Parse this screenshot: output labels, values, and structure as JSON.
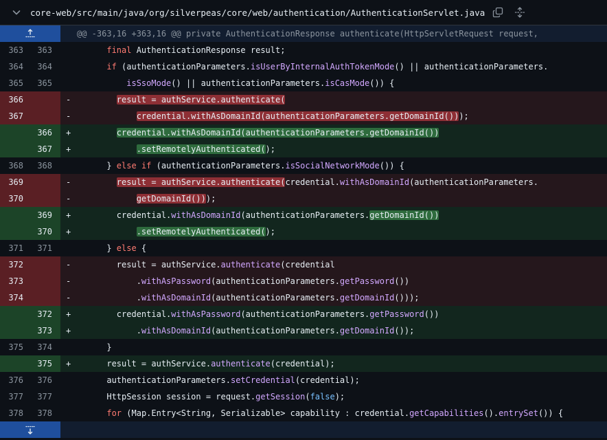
{
  "file": {
    "path": "core-web/src/main/java/org/silverpeas/core/web/authentication/AuthenticationServlet.java"
  },
  "hunk": {
    "header": "@@ -363,16 +363,16 @@ private AuthenticationResponse authenticate(HttpServletRequest request,"
  },
  "lines": [
    {
      "old": "363",
      "new": "363",
      "sign": "",
      "type": "ctx",
      "segs": [
        {
          "t": "      "
        },
        {
          "t": "final",
          "c": "kw"
        },
        {
          "t": " AuthenticationResponse result;"
        }
      ]
    },
    {
      "old": "364",
      "new": "364",
      "sign": "",
      "type": "ctx",
      "segs": [
        {
          "t": "      "
        },
        {
          "t": "if",
          "c": "kw"
        },
        {
          "t": " (authenticationParameters."
        },
        {
          "t": "isUserByInternalAuthTokenMode",
          "c": "fn"
        },
        {
          "t": "() || authenticationParameters."
        }
      ]
    },
    {
      "old": "365",
      "new": "365",
      "sign": "",
      "type": "ctx",
      "segs": [
        {
          "t": "          "
        },
        {
          "t": "isSsoMode",
          "c": "fn"
        },
        {
          "t": "() || authenticationParameters."
        },
        {
          "t": "isCasMode",
          "c": "fn"
        },
        {
          "t": "()) {"
        }
      ]
    },
    {
      "old": "366",
      "new": "",
      "sign": "-",
      "type": "del",
      "segs": [
        {
          "t": "        "
        },
        {
          "t": "result = authService.authenticate(",
          "c": "hl-del"
        }
      ]
    },
    {
      "old": "367",
      "new": "",
      "sign": "-",
      "type": "del",
      "segs": [
        {
          "t": "            "
        },
        {
          "t": "credential.withAsDomainId(authenticationParameters.getDomainId())",
          "c": "hl-del"
        },
        {
          "t": ");"
        }
      ]
    },
    {
      "old": "",
      "new": "366",
      "sign": "+",
      "type": "add",
      "segs": [
        {
          "t": "        "
        },
        {
          "t": "credential.withAsDomainId(authenticationParameters.getDomainId())",
          "c": "hl-add"
        }
      ]
    },
    {
      "old": "",
      "new": "367",
      "sign": "+",
      "type": "add",
      "segs": [
        {
          "t": "            "
        },
        {
          "t": ".setRemotelyAuthenticated(",
          "c": "hl-add"
        },
        {
          "t": ");"
        }
      ]
    },
    {
      "old": "368",
      "new": "368",
      "sign": "",
      "type": "ctx",
      "segs": [
        {
          "t": "      } "
        },
        {
          "t": "else",
          "c": "kw"
        },
        {
          "t": " "
        },
        {
          "t": "if",
          "c": "kw"
        },
        {
          "t": " (authenticationParameters."
        },
        {
          "t": "isSocialNetworkMode",
          "c": "fn"
        },
        {
          "t": "()) {"
        }
      ]
    },
    {
      "old": "369",
      "new": "",
      "sign": "-",
      "type": "del",
      "segs": [
        {
          "t": "        "
        },
        {
          "t": "result = authService.authenticate(",
          "c": "hl-del"
        },
        {
          "t": "credential."
        },
        {
          "t": "withAsDomainId",
          "c": "fn"
        },
        {
          "t": "(authenticationParameters."
        }
      ]
    },
    {
      "old": "370",
      "new": "",
      "sign": "-",
      "type": "del",
      "segs": [
        {
          "t": "            "
        },
        {
          "t": "getDomainId())",
          "c": "hl-del"
        },
        {
          "t": ");"
        }
      ]
    },
    {
      "old": "",
      "new": "369",
      "sign": "+",
      "type": "add",
      "segs": [
        {
          "t": "        credential."
        },
        {
          "t": "withAsDomainId",
          "c": "fn"
        },
        {
          "t": "(authenticationParameters."
        },
        {
          "t": "getDomainId())",
          "c": "hl-add"
        }
      ]
    },
    {
      "old": "",
      "new": "370",
      "sign": "+",
      "type": "add",
      "segs": [
        {
          "t": "            "
        },
        {
          "t": ".setRemotelyAuthenticated(",
          "c": "hl-add"
        },
        {
          "t": ");"
        }
      ]
    },
    {
      "old": "371",
      "new": "371",
      "sign": "",
      "type": "ctx",
      "segs": [
        {
          "t": "      } "
        },
        {
          "t": "else",
          "c": "kw"
        },
        {
          "t": " {"
        }
      ]
    },
    {
      "old": "372",
      "new": "",
      "sign": "-",
      "type": "del",
      "segs": [
        {
          "t": "        result = authService."
        },
        {
          "t": "authenticate",
          "c": "fn"
        },
        {
          "t": "(credential"
        }
      ]
    },
    {
      "old": "373",
      "new": "",
      "sign": "-",
      "type": "del",
      "segs": [
        {
          "t": "            ."
        },
        {
          "t": "withAsPassword",
          "c": "fn"
        },
        {
          "t": "(authenticationParameters."
        },
        {
          "t": "getPassword",
          "c": "fn"
        },
        {
          "t": "())"
        }
      ]
    },
    {
      "old": "374",
      "new": "",
      "sign": "-",
      "type": "del",
      "segs": [
        {
          "t": "            ."
        },
        {
          "t": "withAsDomainId",
          "c": "fn"
        },
        {
          "t": "(authenticationParameters."
        },
        {
          "t": "getDomainId",
          "c": "fn"
        },
        {
          "t": "()));"
        }
      ]
    },
    {
      "old": "",
      "new": "372",
      "sign": "+",
      "type": "add",
      "segs": [
        {
          "t": "        credential."
        },
        {
          "t": "withAsPassword",
          "c": "fn"
        },
        {
          "t": "(authenticationParameters."
        },
        {
          "t": "getPassword",
          "c": "fn"
        },
        {
          "t": "())"
        }
      ]
    },
    {
      "old": "",
      "new": "373",
      "sign": "+",
      "type": "add",
      "segs": [
        {
          "t": "            ."
        },
        {
          "t": "withAsDomainId",
          "c": "fn"
        },
        {
          "t": "(authenticationParameters."
        },
        {
          "t": "getDomainId",
          "c": "fn"
        },
        {
          "t": "());"
        }
      ]
    },
    {
      "old": "375",
      "new": "374",
      "sign": "",
      "type": "ctx",
      "segs": [
        {
          "t": "      }"
        }
      ]
    },
    {
      "old": "",
      "new": "375",
      "sign": "+",
      "type": "add",
      "segs": [
        {
          "t": "      result = authService."
        },
        {
          "t": "authenticate",
          "c": "fn"
        },
        {
          "t": "(credential);"
        }
      ]
    },
    {
      "old": "376",
      "new": "376",
      "sign": "",
      "type": "ctx",
      "segs": [
        {
          "t": "      authenticationParameters."
        },
        {
          "t": "setCredential",
          "c": "fn"
        },
        {
          "t": "(credential);"
        }
      ]
    },
    {
      "old": "377",
      "new": "377",
      "sign": "",
      "type": "ctx",
      "segs": [
        {
          "t": "      HttpSession session = request."
        },
        {
          "t": "getSession",
          "c": "fn"
        },
        {
          "t": "("
        },
        {
          "t": "false",
          "c": "lit"
        },
        {
          "t": ");"
        }
      ]
    },
    {
      "old": "378",
      "new": "378",
      "sign": "",
      "type": "ctx",
      "segs": [
        {
          "t": "      "
        },
        {
          "t": "for",
          "c": "kw"
        },
        {
          "t": " (Map.Entry<String, Serializable> capability : credential."
        },
        {
          "t": "getCapabilities",
          "c": "fn"
        },
        {
          "t": "()."
        },
        {
          "t": "entrySet",
          "c": "fn"
        },
        {
          "t": "()) {"
        }
      ]
    }
  ]
}
